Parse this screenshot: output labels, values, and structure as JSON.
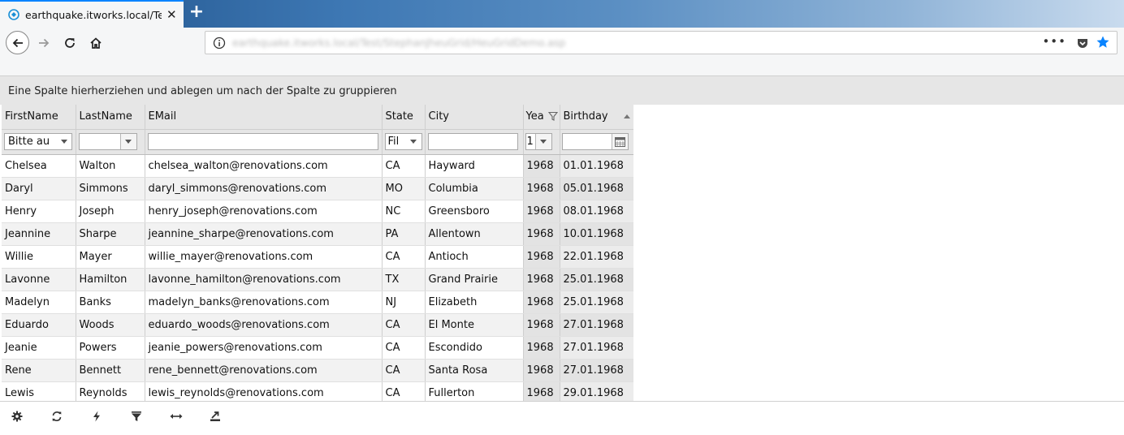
{
  "browser": {
    "tab_title": "earthquake.itworks.local/Test/S",
    "url": "earthquake.itworks.local/Test/StephanJheuGrid/HeuGridDemo.asp",
    "more_label": "•••"
  },
  "group_bar": {
    "text": "Eine Spalte hierherziehen und ablegen um nach der Spalte zu gruppieren"
  },
  "grid": {
    "columns": [
      "FirstName",
      "LastName",
      "EMail",
      "State",
      "City",
      "Yea",
      "Birthday"
    ],
    "filters": {
      "firstname": "Bitte au",
      "lastname": "",
      "email": "",
      "state": "Fil",
      "city": "",
      "year": "1",
      "birthday": ""
    },
    "rows": [
      [
        "Chelsea",
        "Walton",
        "chelsea_walton@renovations.com",
        "CA",
        "Hayward",
        "1968",
        "01.01.1968"
      ],
      [
        "Daryl",
        "Simmons",
        "daryl_simmons@renovations.com",
        "MO",
        "Columbia",
        "1968",
        "05.01.1968"
      ],
      [
        "Henry",
        "Joseph",
        "henry_joseph@renovations.com",
        "NC",
        "Greensboro",
        "1968",
        "08.01.1968"
      ],
      [
        "Jeannine",
        "Sharpe",
        "jeannine_sharpe@renovations.com",
        "PA",
        "Allentown",
        "1968",
        "10.01.1968"
      ],
      [
        "Willie",
        "Mayer",
        "willie_mayer@renovations.com",
        "CA",
        "Antioch",
        "1968",
        "22.01.1968"
      ],
      [
        "Lavonne",
        "Hamilton",
        "lavonne_hamilton@renovations.com",
        "TX",
        "Grand Prairie",
        "1968",
        "25.01.1968"
      ],
      [
        "Madelyn",
        "Banks",
        "madelyn_banks@renovations.com",
        "NJ",
        "Elizabeth",
        "1968",
        "25.01.1968"
      ],
      [
        "Eduardo",
        "Woods",
        "eduardo_woods@renovations.com",
        "CA",
        "El Monte",
        "1968",
        "27.01.1968"
      ],
      [
        "Jeanie",
        "Powers",
        "jeanie_powers@renovations.com",
        "CA",
        "Escondido",
        "1968",
        "27.01.1968"
      ],
      [
        "Rene",
        "Bennett",
        "rene_bennett@renovations.com",
        "CA",
        "Santa Rosa",
        "1968",
        "27.01.1968"
      ],
      [
        "Lewis",
        "Reynolds",
        "lewis_reynolds@renovations.com",
        "CA",
        "Fullerton",
        "1968",
        "29.01.1968"
      ]
    ]
  },
  "toolbar": {
    "icons": [
      "gear-icon",
      "refresh-icon",
      "lightning-icon",
      "filter-icon",
      "resize-horizontal-icon",
      "export-icon"
    ]
  },
  "colors": {
    "accent": "#0a84ff",
    "header_bg": "#e6e6e6"
  }
}
